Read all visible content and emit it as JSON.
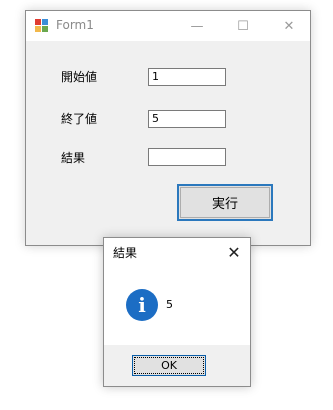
{
  "form": {
    "title": "Form1",
    "controls": {
      "minimize": "—",
      "maximize": "☐",
      "close": "✕"
    },
    "labels": {
      "start": "開始値",
      "end": "終了値",
      "result": "結果"
    },
    "inputs": {
      "start_value": "1",
      "end_value": "5",
      "result_value": ""
    },
    "run_button": "実行"
  },
  "message_box": {
    "title": "結果",
    "close": "✕",
    "icon": "i",
    "text": "5",
    "ok_button": "OK"
  },
  "colors": {
    "accent": "#2b78bd",
    "info_icon": "#1c6dc4"
  }
}
